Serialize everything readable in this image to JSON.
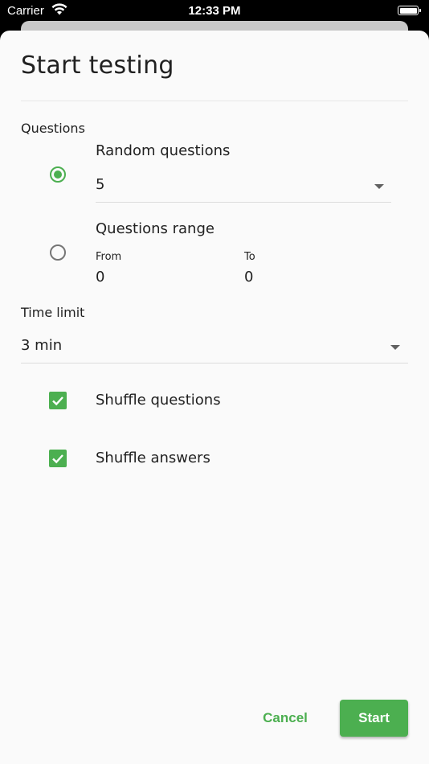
{
  "status_bar": {
    "carrier": "Carrier",
    "time": "12:33 PM"
  },
  "dialog": {
    "title": "Start testing",
    "questions": {
      "label": "Questions",
      "random": {
        "label": "Random questions",
        "selected": true,
        "count_value": "5"
      },
      "range": {
        "label": "Questions range",
        "selected": false,
        "from_label": "From",
        "from_value": "0",
        "to_label": "To",
        "to_value": "0"
      }
    },
    "time_limit": {
      "label": "Time limit",
      "value": "3 min"
    },
    "options": {
      "shuffle_questions": {
        "label": "Shuffle questions",
        "checked": true
      },
      "shuffle_answers": {
        "label": "Shuffle answers",
        "checked": true
      }
    },
    "actions": {
      "cancel_label": "Cancel",
      "start_label": "Start"
    }
  },
  "colors": {
    "accent": "#4caf50",
    "text": "#212121",
    "background": "#fafafa"
  }
}
